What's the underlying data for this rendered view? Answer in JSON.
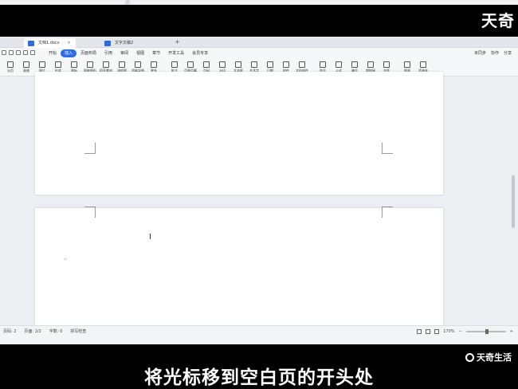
{
  "watermark": {
    "top": "天奇",
    "bottom": "天奇生活"
  },
  "tabs": [
    {
      "label": "文档1.docx",
      "active": true
    },
    {
      "label": "文字文稿2",
      "active": false
    }
  ],
  "menu": [
    "开始",
    "插入",
    "页面布局",
    "引用",
    "审阅",
    "视图",
    "章节",
    "开发工具",
    "会员专享"
  ],
  "active_menu_index": 1,
  "menu_right": [
    "未同步",
    "协作",
    "分享"
  ],
  "ribbon": [
    "分页",
    "表格",
    "图片",
    "形状",
    "图标",
    "智能图形",
    "稻壳素材",
    "流程图",
    "思维导图",
    "更多",
    "批注",
    "页眉页脚",
    "页码",
    "水印",
    "文本框",
    "艺术字",
    "日期",
    "附件",
    "文档部件",
    "符号",
    "公式",
    "编号",
    "超链接",
    "书签",
    "图表",
    "资源夹"
  ],
  "status": {
    "left": [
      "页码: 2",
      "页面: 2/2",
      "字数: 0",
      "拼写检查"
    ],
    "zoom": "170%"
  },
  "subtitle": "将光标移到空白页的开头处"
}
